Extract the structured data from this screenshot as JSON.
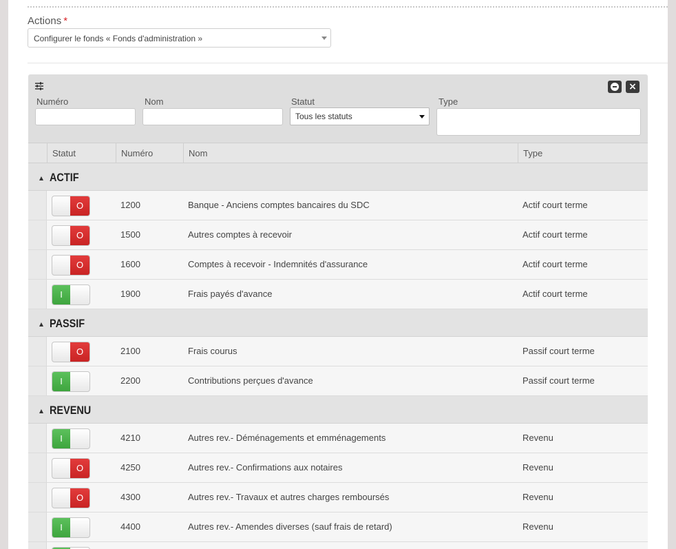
{
  "actions": {
    "label": "Actions",
    "required_mark": "*",
    "selected": "Configurer le fonds « Fonds d'administration »"
  },
  "filters": {
    "numero_label": "Numéro",
    "nom_label": "Nom",
    "statut_label": "Statut",
    "statut_selected": "Tous les statuts",
    "type_label": "Type"
  },
  "table": {
    "columns": [
      "Statut",
      "Numéro",
      "Nom",
      "Type"
    ],
    "on_label": "I",
    "off_label": "O",
    "groups": [
      {
        "title": "ACTIF",
        "rows": [
          {
            "active": false,
            "numero": "1200",
            "nom": "Banque - Anciens comptes bancaires du SDC",
            "type": "Actif court terme"
          },
          {
            "active": false,
            "numero": "1500",
            "nom": "Autres comptes à recevoir",
            "type": "Actif court terme"
          },
          {
            "active": false,
            "numero": "1600",
            "nom": "Comptes à recevoir - Indemnités d'assurance",
            "type": "Actif court terme"
          },
          {
            "active": true,
            "numero": "1900",
            "nom": "Frais payés d'avance",
            "type": "Actif court terme"
          }
        ]
      },
      {
        "title": "PASSIF",
        "rows": [
          {
            "active": false,
            "numero": "2100",
            "nom": "Frais courus",
            "type": "Passif court terme"
          },
          {
            "active": true,
            "numero": "2200",
            "nom": "Contributions perçues d'avance",
            "type": "Passif court terme"
          }
        ]
      },
      {
        "title": "REVENU",
        "rows": [
          {
            "active": true,
            "numero": "4210",
            "nom": "Autres rev.- Déménagements et emménagements",
            "type": "Revenu"
          },
          {
            "active": false,
            "numero": "4250",
            "nom": "Autres rev.- Confirmations aux notaires",
            "type": "Revenu"
          },
          {
            "active": false,
            "numero": "4300",
            "nom": "Autres rev.- Travaux et autres charges remboursés",
            "type": "Revenu"
          },
          {
            "active": true,
            "numero": "4400",
            "nom": "Autres rev.- Amendes diverses (sauf frais de retard)",
            "type": "Revenu"
          },
          {
            "active": true,
            "numero": "",
            "nom": "",
            "type": ""
          }
        ]
      }
    ]
  }
}
